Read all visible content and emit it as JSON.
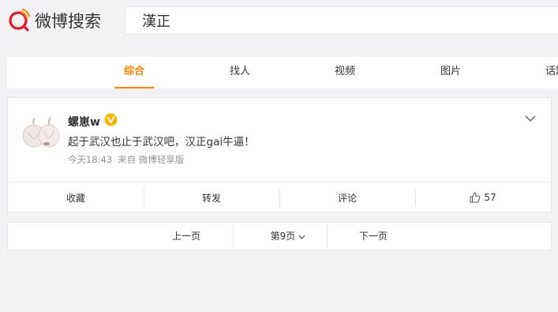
{
  "header": {
    "logo_text": "微博搜索",
    "search_value": "漢正"
  },
  "tabs": [
    {
      "label": "综合",
      "active": true
    },
    {
      "label": "找人"
    },
    {
      "label": "视频"
    },
    {
      "label": "图片"
    },
    {
      "label": "话题"
    }
  ],
  "post": {
    "username": "螺崽w",
    "content": "起于武汉也止于武汉吧，汉正gai牛逼！",
    "time": "今天18:43",
    "source": "来自 微博轻享版",
    "actions": {
      "favorite": "收藏",
      "repost": "转发",
      "comment": "评论",
      "like_count": "57"
    }
  },
  "pagination": {
    "prev": "上一页",
    "current": "第9页",
    "next": "下一页"
  },
  "colors": {
    "accent": "#ff8200",
    "logo_red": "#e6162d",
    "badge": "#f7b500"
  }
}
